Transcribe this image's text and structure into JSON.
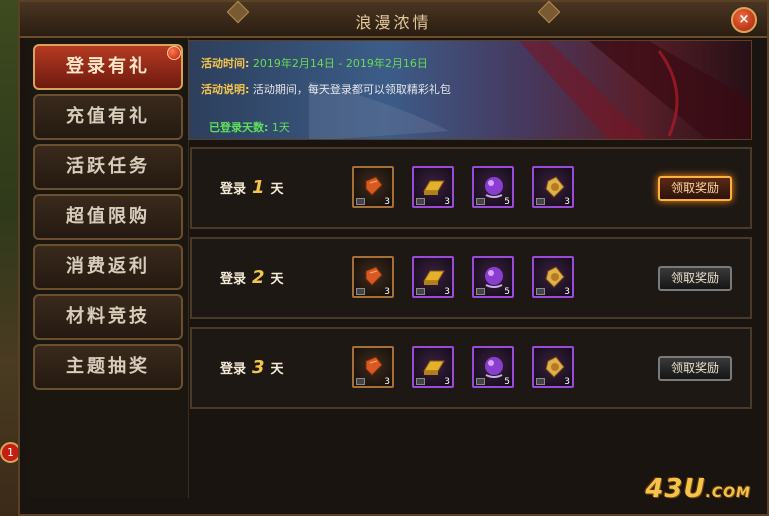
{
  "window": {
    "title": "浪漫浓情",
    "close_icon": "×"
  },
  "sidebar": {
    "items": [
      {
        "label": "登录有礼",
        "active": true
      },
      {
        "label": "充值有礼"
      },
      {
        "label": "活跃任务"
      },
      {
        "label": "超值限购"
      },
      {
        "label": "消费返利"
      },
      {
        "label": "材料竞技"
      },
      {
        "label": "主题抽奖"
      }
    ]
  },
  "banner": {
    "time_label": "活动时间:",
    "time_value": "2019年2月14日 - 2019年2月16日",
    "desc_label": "活动说明:",
    "desc_value": "活动期间，每天登录都可以领取精彩礼包",
    "days_label": "已登录天数:",
    "days_value": "1天"
  },
  "rows": [
    {
      "prefix": "登录",
      "day": "1",
      "suffix": "天",
      "button": "领取奖励",
      "button_active": true
    },
    {
      "prefix": "登录",
      "day": "2",
      "suffix": "天",
      "button": "领取奖励",
      "button_active": false
    },
    {
      "prefix": "登录",
      "day": "3",
      "suffix": "天",
      "button": "领取奖励",
      "button_active": false
    }
  ],
  "reward_items": [
    {
      "icon": "red-book-icon",
      "count": "3"
    },
    {
      "icon": "gold-bar-icon",
      "count": "3"
    },
    {
      "icon": "purple-orb-icon",
      "count": "5"
    },
    {
      "icon": "gold-token-icon",
      "count": "3"
    }
  ],
  "left_badge": "1",
  "logo": {
    "main": "43U",
    "suffix": ".COM"
  },
  "colors": {
    "accent_gold": "#f3c64a",
    "active_red": "#b53a22",
    "days_green": "#5ee05a"
  }
}
